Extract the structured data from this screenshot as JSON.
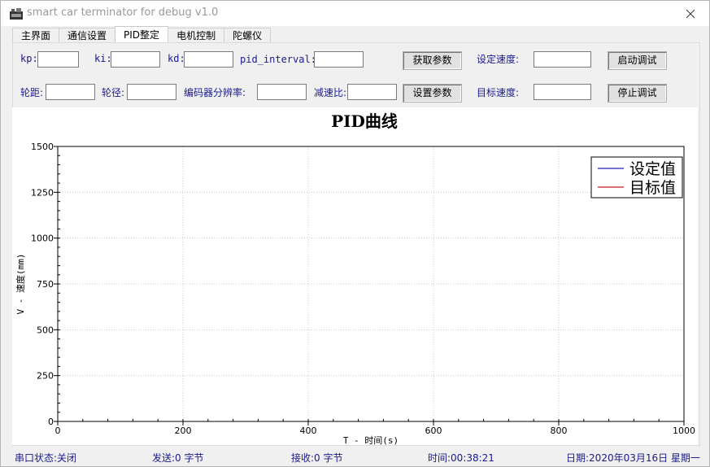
{
  "window": {
    "title": "smart car terminator for debug v1.0"
  },
  "tabs": [
    "主界面",
    "通信设置",
    "PID整定",
    "电机控制",
    "陀螺仪"
  ],
  "form": {
    "kp_label": "kp:",
    "ki_label": "ki:",
    "kd_label": "kd:",
    "pid_interval_label": "pid_interval:",
    "get_params_button": "获取参数",
    "set_speed_label": "设定速度:",
    "start_debug_button": "启动调试",
    "wheelbase_label": "轮距:",
    "wheel_diameter_label": "轮径:",
    "encoder_resolution_label": "编码器分辨率:",
    "reduction_ratio_label": "减速比:",
    "set_params_button": "设置参数",
    "target_speed_label": "目标速度:",
    "stop_debug_button": "停止调试"
  },
  "chart_data": {
    "type": "line",
    "title": "PID曲线",
    "xlabel": "T - 时间(s)",
    "ylabel": "V - 速度(mm)",
    "xlim": [
      0,
      1000
    ],
    "ylim": [
      0,
      1500
    ],
    "x_ticks": [
      0,
      200,
      400,
      600,
      800,
      1000
    ],
    "y_ticks": [
      0,
      250,
      500,
      750,
      1000,
      1250,
      1500
    ],
    "grid": true,
    "legend_position": "top-right",
    "series": [
      {
        "name": "设定值",
        "color": "#1f1fbf",
        "values": []
      },
      {
        "name": "目标值",
        "color": "#bf1f1f",
        "values": []
      }
    ]
  },
  "status": {
    "serial_state": "串口状态:关闭",
    "sent": "发送:0 字节",
    "received": "接收:0 字节",
    "time": "时间:00:38:21",
    "date": "日期:2020年03月16日 星期一"
  }
}
